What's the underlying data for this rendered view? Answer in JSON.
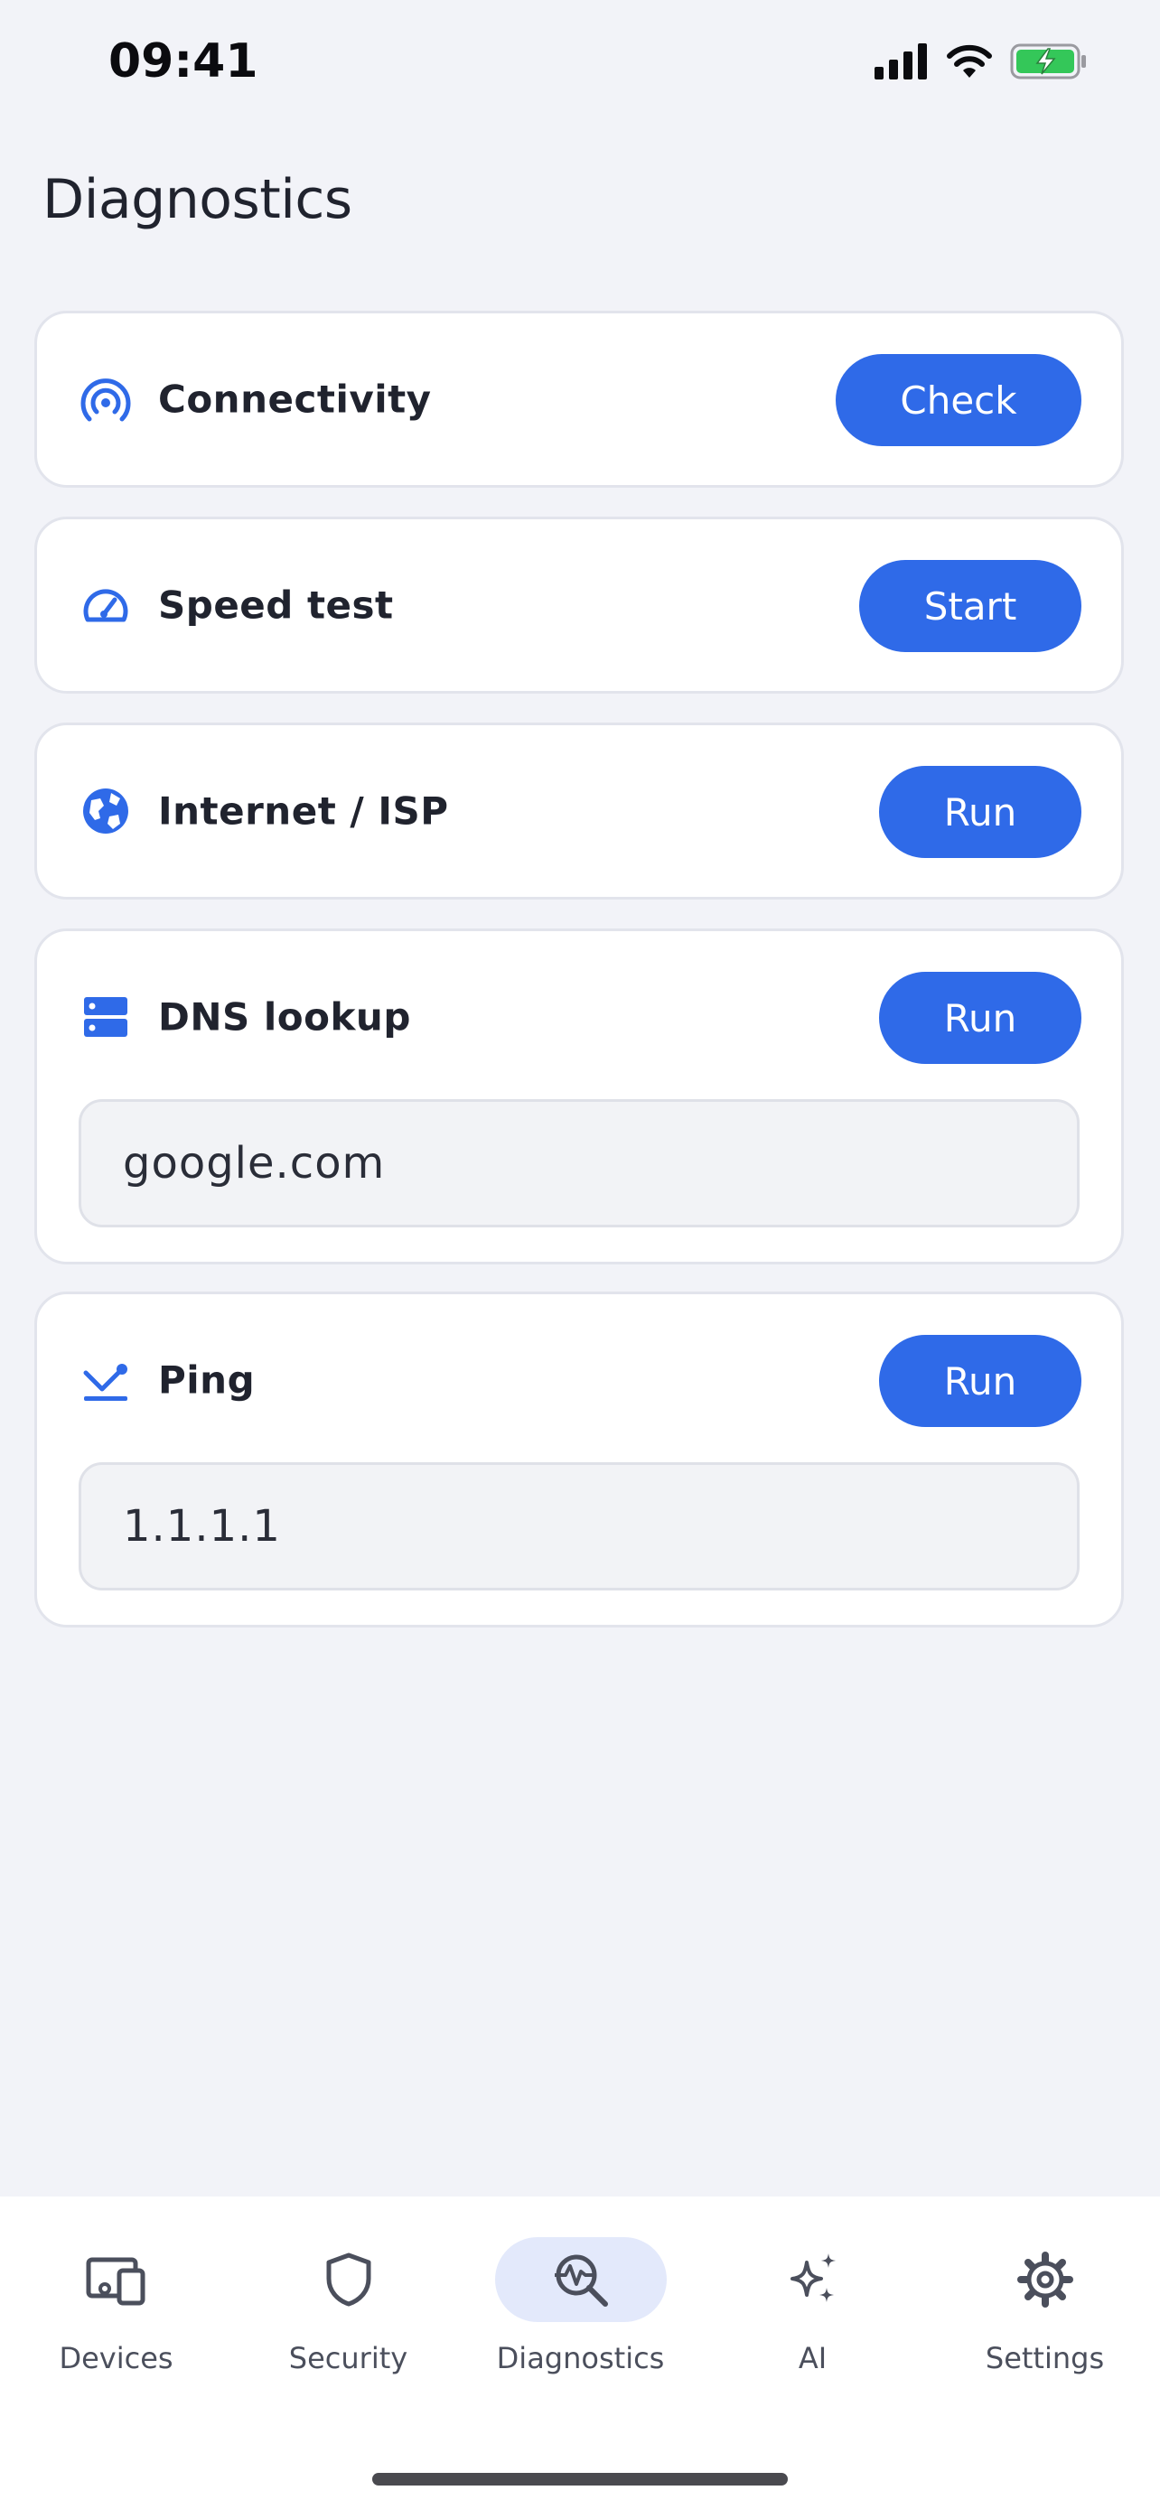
{
  "status": {
    "time": "09:41"
  },
  "page": {
    "title": "Diagnostics"
  },
  "accent_color": "#2f6ae8",
  "cards": {
    "connectivity": {
      "icon": "signal-waves-icon",
      "title": "Connectivity",
      "action": "Check"
    },
    "speed": {
      "icon": "speedometer-icon",
      "title": "Speed test",
      "action": "Start"
    },
    "isp": {
      "icon": "globe-icon",
      "title": "Internet / ISP",
      "action": "Run"
    },
    "dns": {
      "icon": "server-icon",
      "title": "DNS lookup",
      "action": "Run",
      "input_value": "google.com"
    },
    "ping": {
      "icon": "ping-icon",
      "title": "Ping",
      "action": "Run",
      "input_value": "1.1.1.1"
    }
  },
  "tabs": [
    {
      "label": "Devices",
      "icon": "devices-icon",
      "active": false
    },
    {
      "label": "Security",
      "icon": "shield-icon",
      "active": false
    },
    {
      "label": "Diagnostics",
      "icon": "diagnostics-search-icon",
      "active": true
    },
    {
      "label": "AI",
      "icon": "sparkles-icon",
      "active": false
    },
    {
      "label": "Settings",
      "icon": "gear-icon",
      "active": false
    }
  ]
}
